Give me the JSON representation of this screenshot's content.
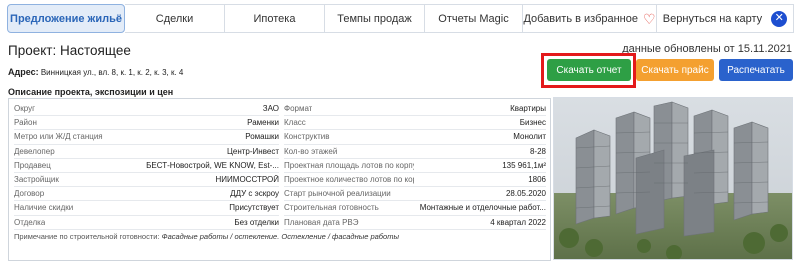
{
  "tabs": [
    {
      "label": "Предложение жильё",
      "active": true
    },
    {
      "label": "Сделки"
    },
    {
      "label": "Ипотека"
    },
    {
      "label": "Темпы продаж"
    },
    {
      "label": "Отчеты Magic"
    },
    {
      "label": "Добавить в избранное",
      "icon": "heart-icon"
    },
    {
      "label": "Вернуться на карту",
      "icon": "close-icon"
    }
  ],
  "header": {
    "project_label": "Проект:",
    "project_name": "Настоящее",
    "updated": "данные обновлены от 15.11.2021",
    "address_label": "Адрес:",
    "address": "Винницкая ул., вл. 8, к. 1, к. 2, к. 3, к. 4"
  },
  "buttons": {
    "report": "Скачать отчет",
    "price": "Скачать прайс",
    "print": "Распечатать"
  },
  "colors": {
    "report": "#2e9f45",
    "price": "#f4a030",
    "print": "#2a62cc",
    "highlight": "#e3191b",
    "active_tab": "#2b66b8"
  },
  "description_title": "Описание проекта, экспозиции и цен",
  "left_rows": [
    {
      "k": "Округ",
      "v": "ЗАО"
    },
    {
      "k": "Район",
      "v": "Раменки"
    },
    {
      "k": "Метро или Ж/Д станция",
      "v": "Ромашки"
    },
    {
      "k": "Девелопер",
      "v": "Центр-Инвест"
    },
    {
      "k": "Продавец",
      "v": "БЕСТ-Новострой, WE KNOW, Est-..."
    },
    {
      "k": "Застройщик",
      "v": "НИИМОССТРОЙ"
    },
    {
      "k": "Договор",
      "v": "ДДУ с эскроу"
    },
    {
      "k": "Наличие скидки",
      "v": "Присутствует"
    },
    {
      "k": "Отделка",
      "v": "Без отделки"
    }
  ],
  "right_rows": [
    {
      "k": "Формат",
      "v": "Квартиры"
    },
    {
      "k": "Класс",
      "v": "Бизнес"
    },
    {
      "k": "Конструктив",
      "v": "Монолит"
    },
    {
      "k": "Кол-во этажей",
      "v": "8-28"
    },
    {
      "k": "Проектная площадь лотов по корпуса...",
      "v": "135 961,1м²"
    },
    {
      "k": "Проектное количество лотов по корп...",
      "v": "1806"
    },
    {
      "k": "Старт рыночной реализации",
      "v": "28.05.2020"
    },
    {
      "k": "Строительная готовность",
      "v": "Монтажные и отделочные работ..."
    },
    {
      "k": "Плановая дата РВЭ",
      "v": "4 квартал 2022"
    }
  ],
  "note": {
    "label": "Примечание по строительной готовности:",
    "text": "Фасадные работы / остекление. Остекление / фасадные работы"
  }
}
